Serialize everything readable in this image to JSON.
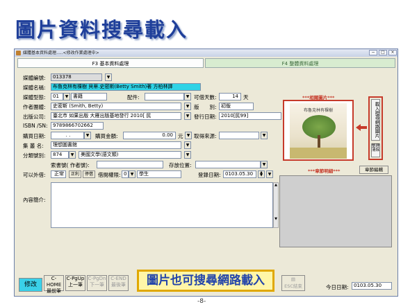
{
  "slide": {
    "title": "圖片資料搜尋載入",
    "page_number": "-8-"
  },
  "window": {
    "title": "媒體基本資料處理.....<修改作業處理中>",
    "btn_min": "−",
    "btn_max": "□",
    "btn_close": "×"
  },
  "tabs": [
    {
      "label": "F3 基本資料處理"
    },
    {
      "label": "F4 整體資料處理"
    }
  ],
  "form": {
    "media_id": {
      "label": "媒體編號:",
      "value": "013378"
    },
    "media_name": {
      "label": "媒體名稱:",
      "value": "布魯克林有棵樹 貝蒂.史密斯(Betty Smith)著 方柏林譯"
    },
    "media_type": {
      "label": "媒體型態:",
      "code": "01",
      "value": "書籍"
    },
    "accessory": {
      "label": "配件:",
      "value": ""
    },
    "loan_days": {
      "label": "可借天數:",
      "value": "14",
      "unit": "天"
    },
    "author": {
      "label": "作者團體:",
      "value": "史密斯 (Smith, Betty)"
    },
    "edition": {
      "label": "版　　別:",
      "value": "初版"
    },
    "publisher": {
      "label": "出版公司:",
      "value": "臺北市 如果出版 大雁出版基地發行 2010[ 民"
    },
    "pub_date": {
      "label": "發行日期:",
      "value": "2010[民99]"
    },
    "isbn": {
      "label": "ISBN /SN:",
      "value": "9789866702662"
    },
    "purchase_date": {
      "label": "購買日期:",
      "value": ". ."
    },
    "purchase_amount": {
      "label": "購買金額:",
      "value": "0.00",
      "unit": "元"
    },
    "source": {
      "label": "取得來源:",
      "value": ""
    },
    "collection": {
      "label": "集 叢 名:",
      "value": "理想圖書館"
    },
    "category": {
      "label": "分類號別:",
      "code": "874",
      "value": "美國文學(語文類)"
    },
    "call_no": {
      "label": "索書號( 作者號):",
      "value": ""
    },
    "storage": {
      "label": "存放位置:",
      "value": ""
    },
    "lendable": {
      "label": "可以外借:",
      "value": "正常",
      "opt1": "正利",
      "opt2": "停借",
      "loan_level_label": "借閱權限:",
      "loan_level_code": "0",
      "loan_level_value": "學生"
    },
    "register_date": {
      "label": "登錄日期:",
      "value": "0103.05.30"
    },
    "summary": {
      "label": "內容簡介:",
      "value": ""
    }
  },
  "image_panel": {
    "header": "***相關圖片***",
    "cover_title": "布魯克林有棵樹",
    "btn_load": "載入搜尋網路圖片",
    "btn_clear": "整理清除",
    "btn_clear_1": "整理",
    "btn_clear_2": "清除"
  },
  "chapter_panel": {
    "header": "***章節明細***",
    "btn_edit": "章節編輯"
  },
  "toolbar": {
    "modify": "修改",
    "home_key": "C-HOME",
    "home": "最前筆",
    "pgup_key": "C-PgUp",
    "pgup": "上一筆",
    "pgdn_key": "C-PgDn",
    "pgdn": "下一筆",
    "end_key": "C-END",
    "end": "最後筆",
    "callout": "圖片也可搜尋網路載入",
    "esc": "ESC結束",
    "today_label": "今日日期:",
    "today": "0103.05.30"
  },
  "colors": {
    "slide_title": "#1f3f9a",
    "highlight_red": "#c63a2a",
    "callout_border": "#e0a800",
    "callout_bg": "#fff6a8",
    "cyan": "#2fd3e6"
  }
}
